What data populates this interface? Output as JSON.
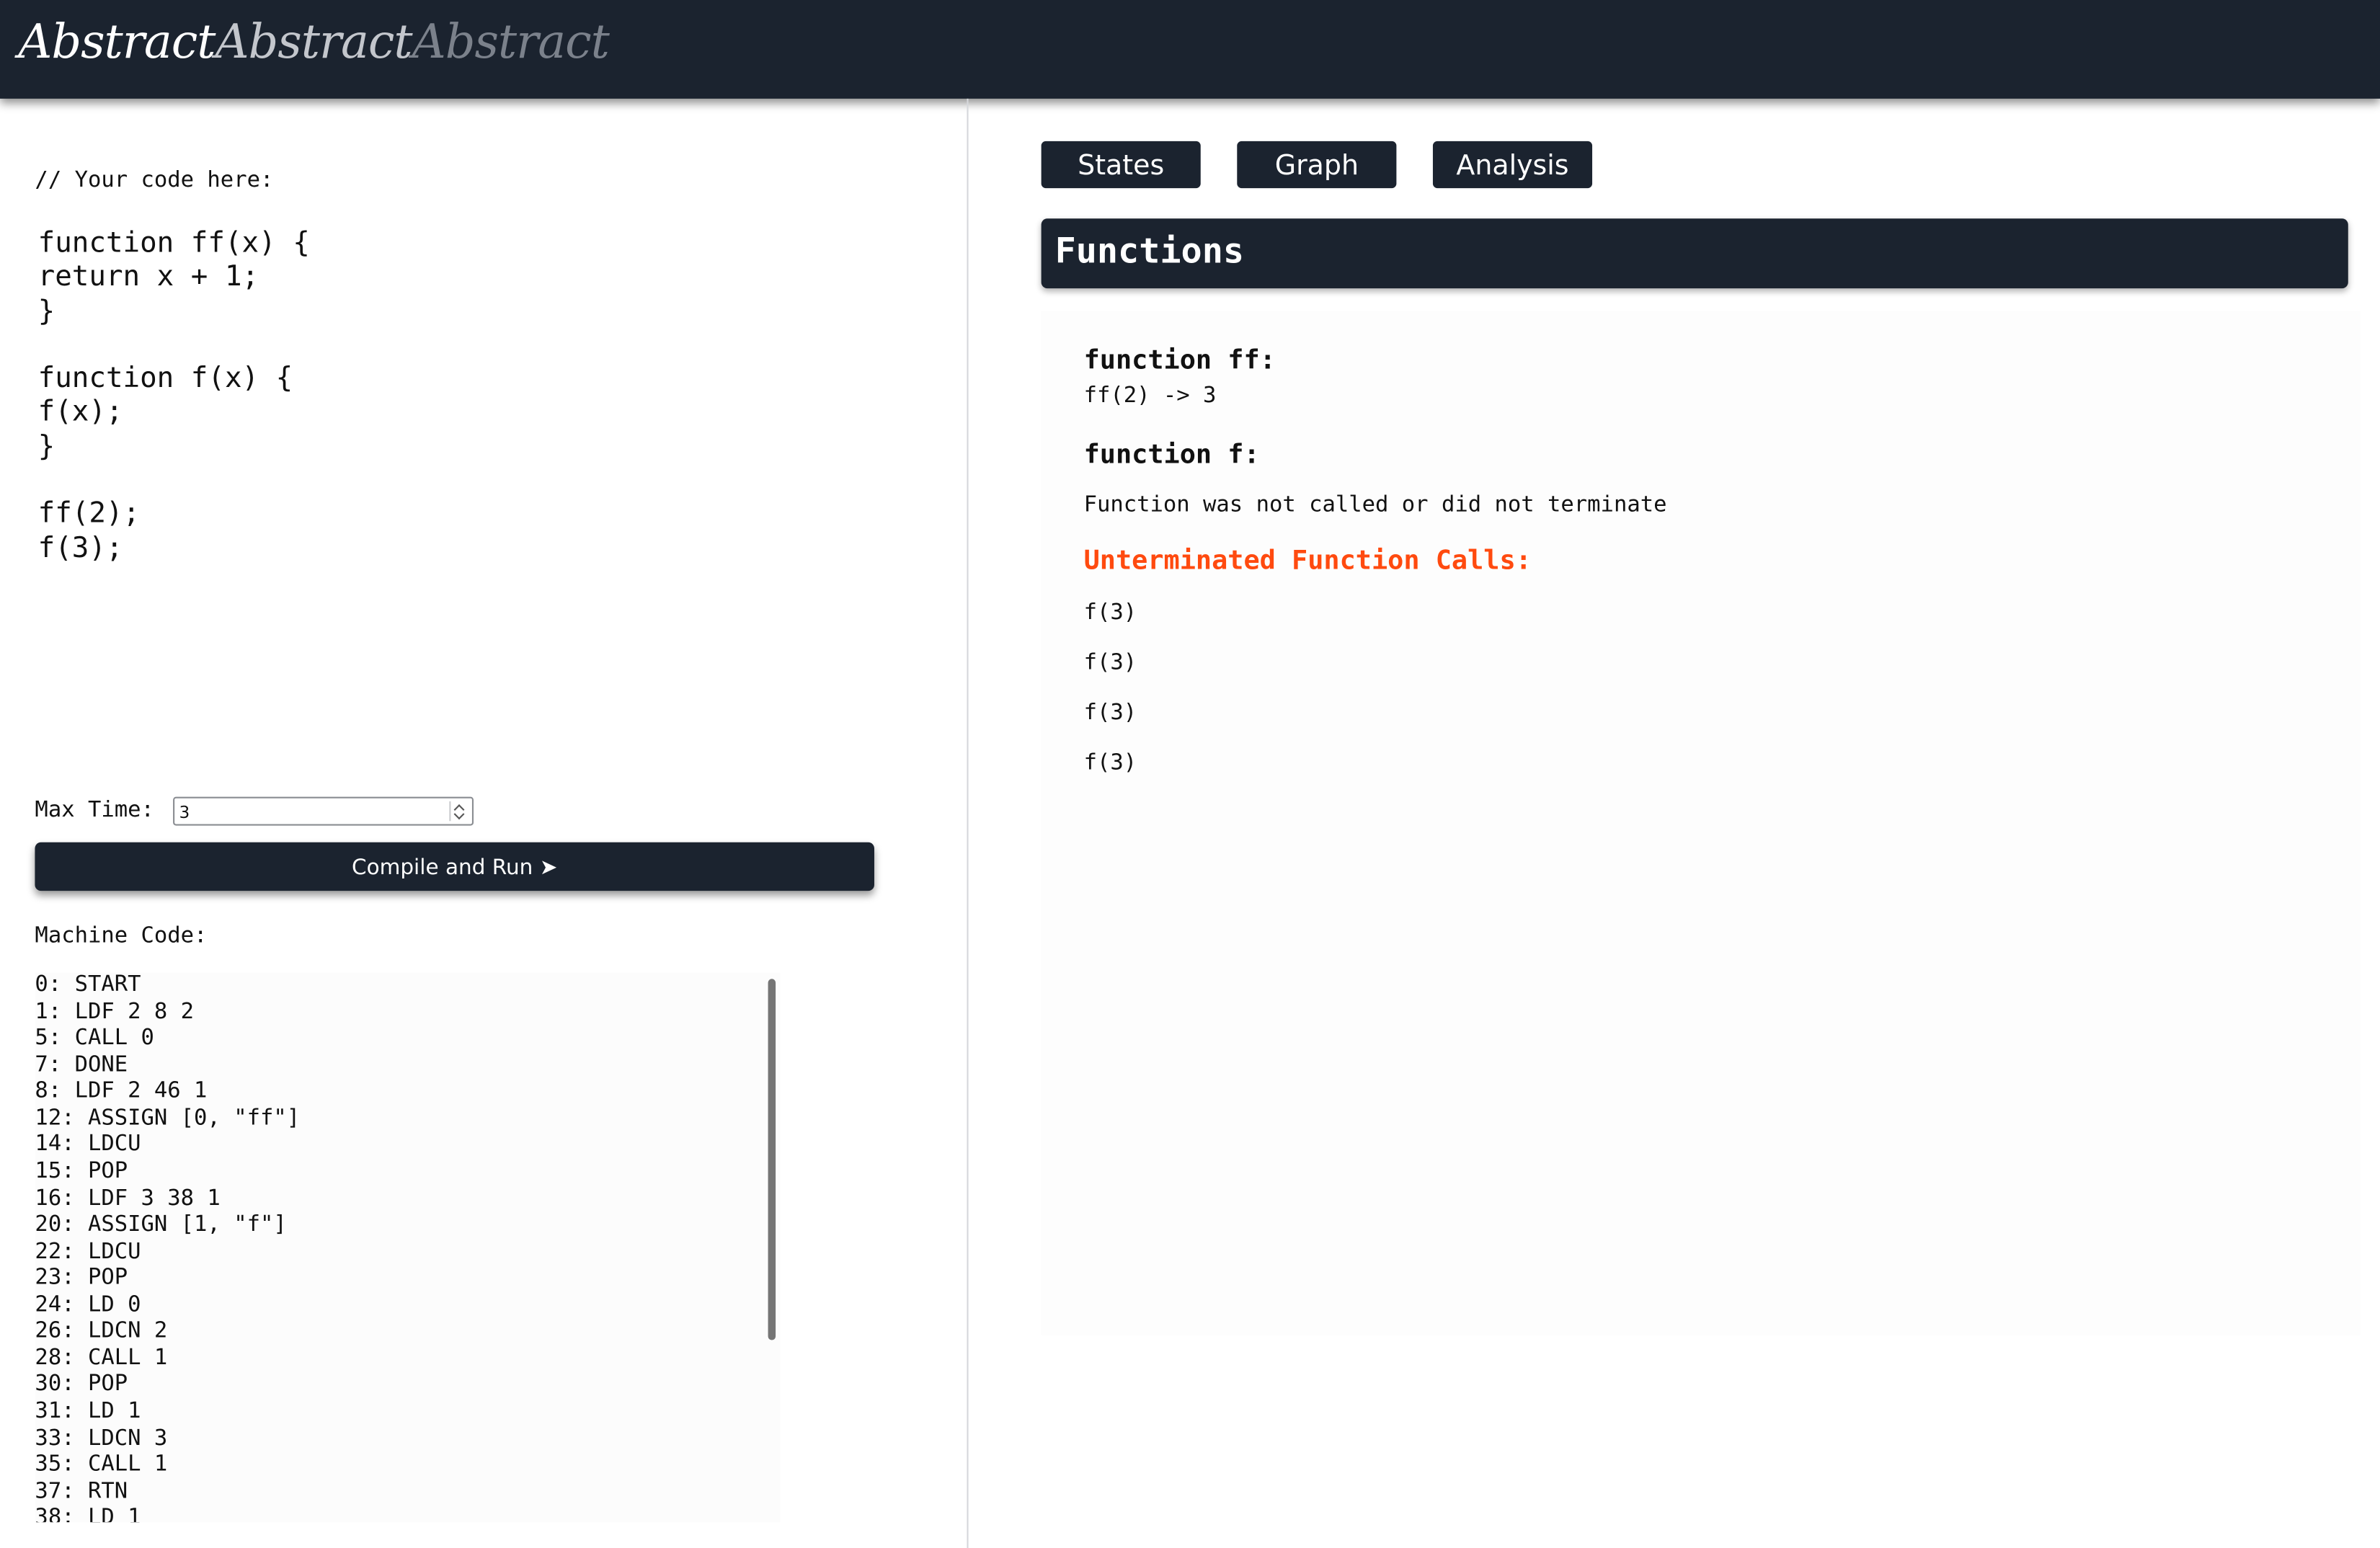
{
  "header": {
    "logo_parts": [
      "Abstract",
      "Abstract",
      "Abstract"
    ]
  },
  "editor": {
    "comment": "// Your code here:",
    "code": "function ff(x) {\nreturn x + 1;\n}\n\nfunction f(x) {\nf(x);\n}\n\nff(2);\nf(3);"
  },
  "controls": {
    "max_time_label": "Max Time:",
    "max_time_value": "3",
    "run_button_label": "Compile and Run ➤"
  },
  "machine": {
    "label": "Machine Code:",
    "lines": [
      "0: START",
      "1: LDF 2 8 2",
      "5: CALL 0",
      "7: DONE",
      "8: LDF 2 46 1",
      "12: ASSIGN [0, \"ff\"]",
      "14: LDCU",
      "15: POP",
      "16: LDF 3 38 1",
      "20: ASSIGN [1, \"f\"]",
      "22: LDCU",
      "23: POP",
      "24: LD 0",
      "26: LDCN 2",
      "28: CALL 1",
      "30: POP",
      "31: LD 1",
      "33: LDCN 3",
      "35: CALL 1",
      "37: RTN",
      "38: LD 1"
    ]
  },
  "tabs": [
    "States",
    "Graph",
    "Analysis"
  ],
  "analysis": {
    "section_title": "Functions",
    "functions": [
      {
        "title": "function ff:",
        "lines": [
          "ff(2) -> 3"
        ]
      },
      {
        "title": "function f:",
        "lines": [
          "Function was not called or did not terminate"
        ]
      }
    ],
    "unterminated_title": "Unterminated Function Calls:",
    "unterminated_calls": [
      "f(3)",
      "f(3)",
      "f(3)",
      "f(3)"
    ]
  },
  "colors": {
    "header_bg": "#1b232f",
    "accent_warning": "#ff4a0f"
  }
}
